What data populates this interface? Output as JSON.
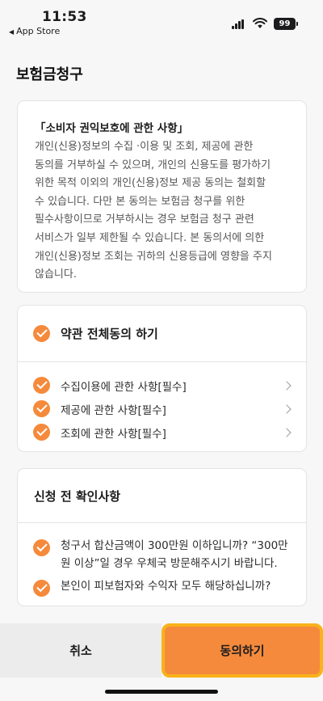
{
  "status_bar": {
    "time": "11:53",
    "back_label": "App Store",
    "battery": "99"
  },
  "page": {
    "title": "보험금청구"
  },
  "notice": {
    "title": "「소비자 권익보호에 관한 사항」",
    "body": "개인(신용)정보의 수집 ·이용 및 조회, 제공에 관한\n동의를 거부하실 수 있으며, 개인의 신용도를 평가하기\n위한 목적 이외의 개인(신용)정보 제공 동의는 철회할\n수 있습니다. 다만 본 동의는 보험금 청구를 위한\n필수사항이므로 거부하시는 경우 보험금 청구 관련\n서비스가 일부 제한될 수 있습니다. 본 동의서에 의한\n개인(신용)정보 조회는 귀하의 신용등급에 영향을 주지\n않습니다."
  },
  "terms": {
    "all_label": "약관 전체동의 하기",
    "items": [
      {
        "label": "수집이용에 관한 사항[필수]"
      },
      {
        "label": "제공에 관한 사항[필수]"
      },
      {
        "label": "조회에 관한 사항[필수]"
      }
    ]
  },
  "confirm": {
    "title": "신청 전 확인사항",
    "items": [
      {
        "label": "청구서 합산금액이 300만원 이하입니까? “300만\n원 이상”일 경우 우체국 방문해주시기 바랍니다."
      },
      {
        "label": "본인이 피보험자와 수익자 모두 해당하십니까?"
      }
    ]
  },
  "buttons": {
    "cancel_label": "취소",
    "agree_label": "동의하기"
  },
  "colors": {
    "accent": "#f58a3c",
    "focus_border": "#f9b21a",
    "cancel_bg": "#ececec",
    "page_bg": "#f7f7f8"
  },
  "icons": {
    "check": "check-circle-icon",
    "chevron": "chevron-right-icon"
  }
}
